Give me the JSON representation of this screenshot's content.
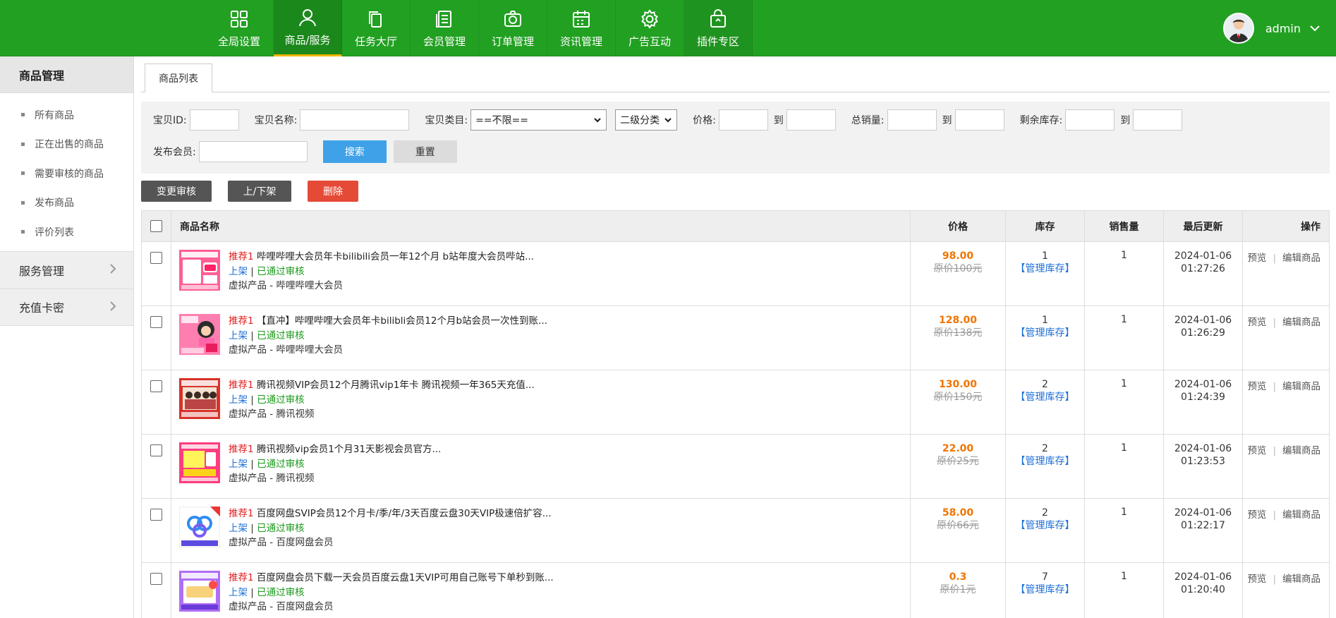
{
  "colors": {
    "header": "#22a022",
    "active_nav": "#1b881b",
    "search_btn": "#3fa2e8",
    "delete_btn": "#e54a36",
    "dark_btn": "#555555"
  },
  "nav": [
    {
      "label": "全局设置",
      "icon": "grid-icon"
    },
    {
      "label": "商品/服务",
      "icon": "user-icon",
      "active": true
    },
    {
      "label": "任务大厅",
      "icon": "copy-icon"
    },
    {
      "label": "会员管理",
      "icon": "list-doc-icon"
    },
    {
      "label": "订单管理",
      "icon": "camera-icon"
    },
    {
      "label": "资讯管理",
      "icon": "calendar-icon"
    },
    {
      "label": "广告互动",
      "icon": "gear-icon"
    },
    {
      "label": "插件专区",
      "icon": "bag-icon"
    }
  ],
  "user": {
    "name": "admin"
  },
  "sidebar": {
    "title": "商品管理",
    "items": [
      "所有商品",
      "正在出售的商品",
      "需要审核的商品",
      "发布商品",
      "评价列表"
    ],
    "groups": [
      "服务管理",
      "充值卡密"
    ]
  },
  "tab": "商品列表",
  "filter": {
    "id_label": "宝贝ID:",
    "name_label": "宝贝名称:",
    "category_label": "宝贝类目:",
    "category_value": "==不限==",
    "subcategory_value": "二级分类",
    "price_label": "价格:",
    "to": "到",
    "sales_label": "总销量:",
    "stock_label": "剩余库存:",
    "member_label": "发布会员:",
    "search_btn": "搜索",
    "reset_btn": "重置"
  },
  "actions": {
    "audit": "变更审核",
    "shelf": "上/下架",
    "delete": "删除"
  },
  "table": {
    "headers": {
      "name": "商品名称",
      "price": "价格",
      "stock": "库存",
      "sales": "销售量",
      "updated": "最后更新",
      "ops": "操作"
    },
    "rows": [
      {
        "tag": "推荐1",
        "title": "哔哩哔哩大会员年卡bilibili会员一年12个月 b站年度大会员哔站...",
        "status": "上架",
        "audit": "已通过审核",
        "category": "虚拟产品 - 哔哩哔哩大会员",
        "price": "98.00",
        "orig": "原价100元",
        "stock": "1",
        "manage": "【管理库存】",
        "sales": "1",
        "date": "2024-01-06",
        "time": "01:27:26",
        "preview": "预览",
        "edit": "编辑商品",
        "thumb": "bilibili-thumb"
      },
      {
        "tag": "推荐1",
        "title": "【直冲】哔哩哔哩大会员年卡bilibli会员12个月b站会员一次性到账...",
        "status": "上架",
        "audit": "已通过审核",
        "category": "虚拟产品 - 哔哩哔哩大会员",
        "price": "128.00",
        "orig": "原价138元",
        "stock": "1",
        "manage": "【管理库存】",
        "sales": "1",
        "date": "2024-01-06",
        "time": "01:26:29",
        "preview": "预览",
        "edit": "编辑商品",
        "thumb": "bilibili2-thumb"
      },
      {
        "tag": "推荐1",
        "title": "腾讯视频VIP会员12个月腾讯vip1年卡 腾讯视频一年365天充值...",
        "status": "上架",
        "audit": "已通过审核",
        "category": "虚拟产品 - 腾讯视频",
        "price": "130.00",
        "orig": "原价150元",
        "stock": "2",
        "manage": "【管理库存】",
        "sales": "1",
        "date": "2024-01-06",
        "time": "01:24:39",
        "preview": "预览",
        "edit": "编辑商品",
        "thumb": "tencent-thumb"
      },
      {
        "tag": "推荐1",
        "title": "腾讯视频vip会员1个月31天影视会员官方...",
        "status": "上架",
        "audit": "已通过审核",
        "category": "虚拟产品 - 腾讯视频",
        "price": "22.00",
        "orig": "原价25元",
        "stock": "2",
        "manage": "【管理库存】",
        "sales": "1",
        "date": "2024-01-06",
        "time": "01:23:53",
        "preview": "预览",
        "edit": "编辑商品",
        "thumb": "tencent2-thumb"
      },
      {
        "tag": "推荐1",
        "title": "百度网盘SVIP会员12个月卡/季/年/3天百度云盘30天VIP极速倍扩容...",
        "status": "上架",
        "audit": "已通过审核",
        "category": "虚拟产品 - 百度网盘会员",
        "price": "58.00",
        "orig": "原价66元",
        "stock": "2",
        "manage": "【管理库存】",
        "sales": "1",
        "date": "2024-01-06",
        "time": "01:22:17",
        "preview": "预览",
        "edit": "编辑商品",
        "thumb": "baidu-thumb"
      },
      {
        "tag": "推荐1",
        "title": "百度网盘会员下载一天会员百度云盘1天VIP可用自己账号下单秒到账...",
        "status": "上架",
        "audit": "已通过审核",
        "category": "虚拟产品 - 百度网盘会员",
        "price": "0.3",
        "orig": "原价1元",
        "stock": "7",
        "manage": "【管理库存】",
        "sales": "1",
        "date": "2024-01-06",
        "time": "01:20:40",
        "preview": "预览",
        "edit": "编辑商品",
        "thumb": "baidu2-thumb"
      }
    ]
  }
}
